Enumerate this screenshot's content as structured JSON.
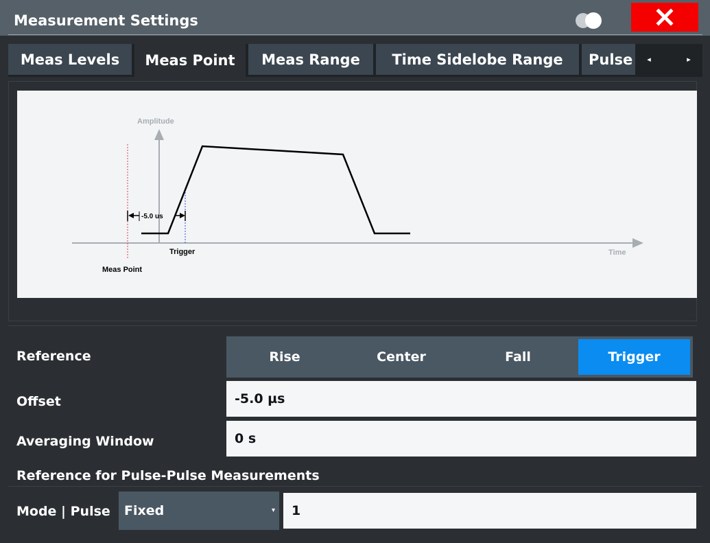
{
  "window": {
    "title": "Measurement Settings",
    "close_glyph": "✕"
  },
  "tabs": [
    {
      "label": "Meas Levels",
      "active": false
    },
    {
      "label": "Meas Point",
      "active": true
    },
    {
      "label": "Meas Range",
      "active": false
    },
    {
      "label": "Time Sidelobe Range",
      "active": false
    },
    {
      "label": "Pulse",
      "active": false
    }
  ],
  "tab_scroll": {
    "left_glyph": "◂",
    "right_glyph": "▸"
  },
  "diagram": {
    "amplitude_label": "Amplitude",
    "time_label": "Time",
    "trigger_label": "Trigger",
    "meas_point_label": "Meas Point",
    "offset_label": "-5.0 us"
  },
  "reference": {
    "label": "Reference",
    "options": [
      "Rise",
      "Center",
      "Fall",
      "Trigger"
    ],
    "selected": "Trigger"
  },
  "offset": {
    "label": "Offset",
    "value": "-5.0 µs"
  },
  "averaging_window": {
    "label": "Averaging Window",
    "value": "0 s"
  },
  "pulse_reference": {
    "section_title": "Reference for Pulse-Pulse Measurements",
    "mode_label": "Mode | Pulse",
    "mode_value": "Fixed",
    "caret_glyph": "▾",
    "pulse_value": "1"
  },
  "colors": {
    "title_bar": "#566069",
    "close_button": "#f40000",
    "selected_option": "#0a8cf0",
    "diagram_background": "#f2f4f6"
  },
  "icons": {
    "close": "close-icon",
    "toggle": "toggle-icon",
    "tab_left": "chevron-left-icon",
    "tab_right": "chevron-right-icon",
    "dropdown": "chevron-down-icon"
  }
}
